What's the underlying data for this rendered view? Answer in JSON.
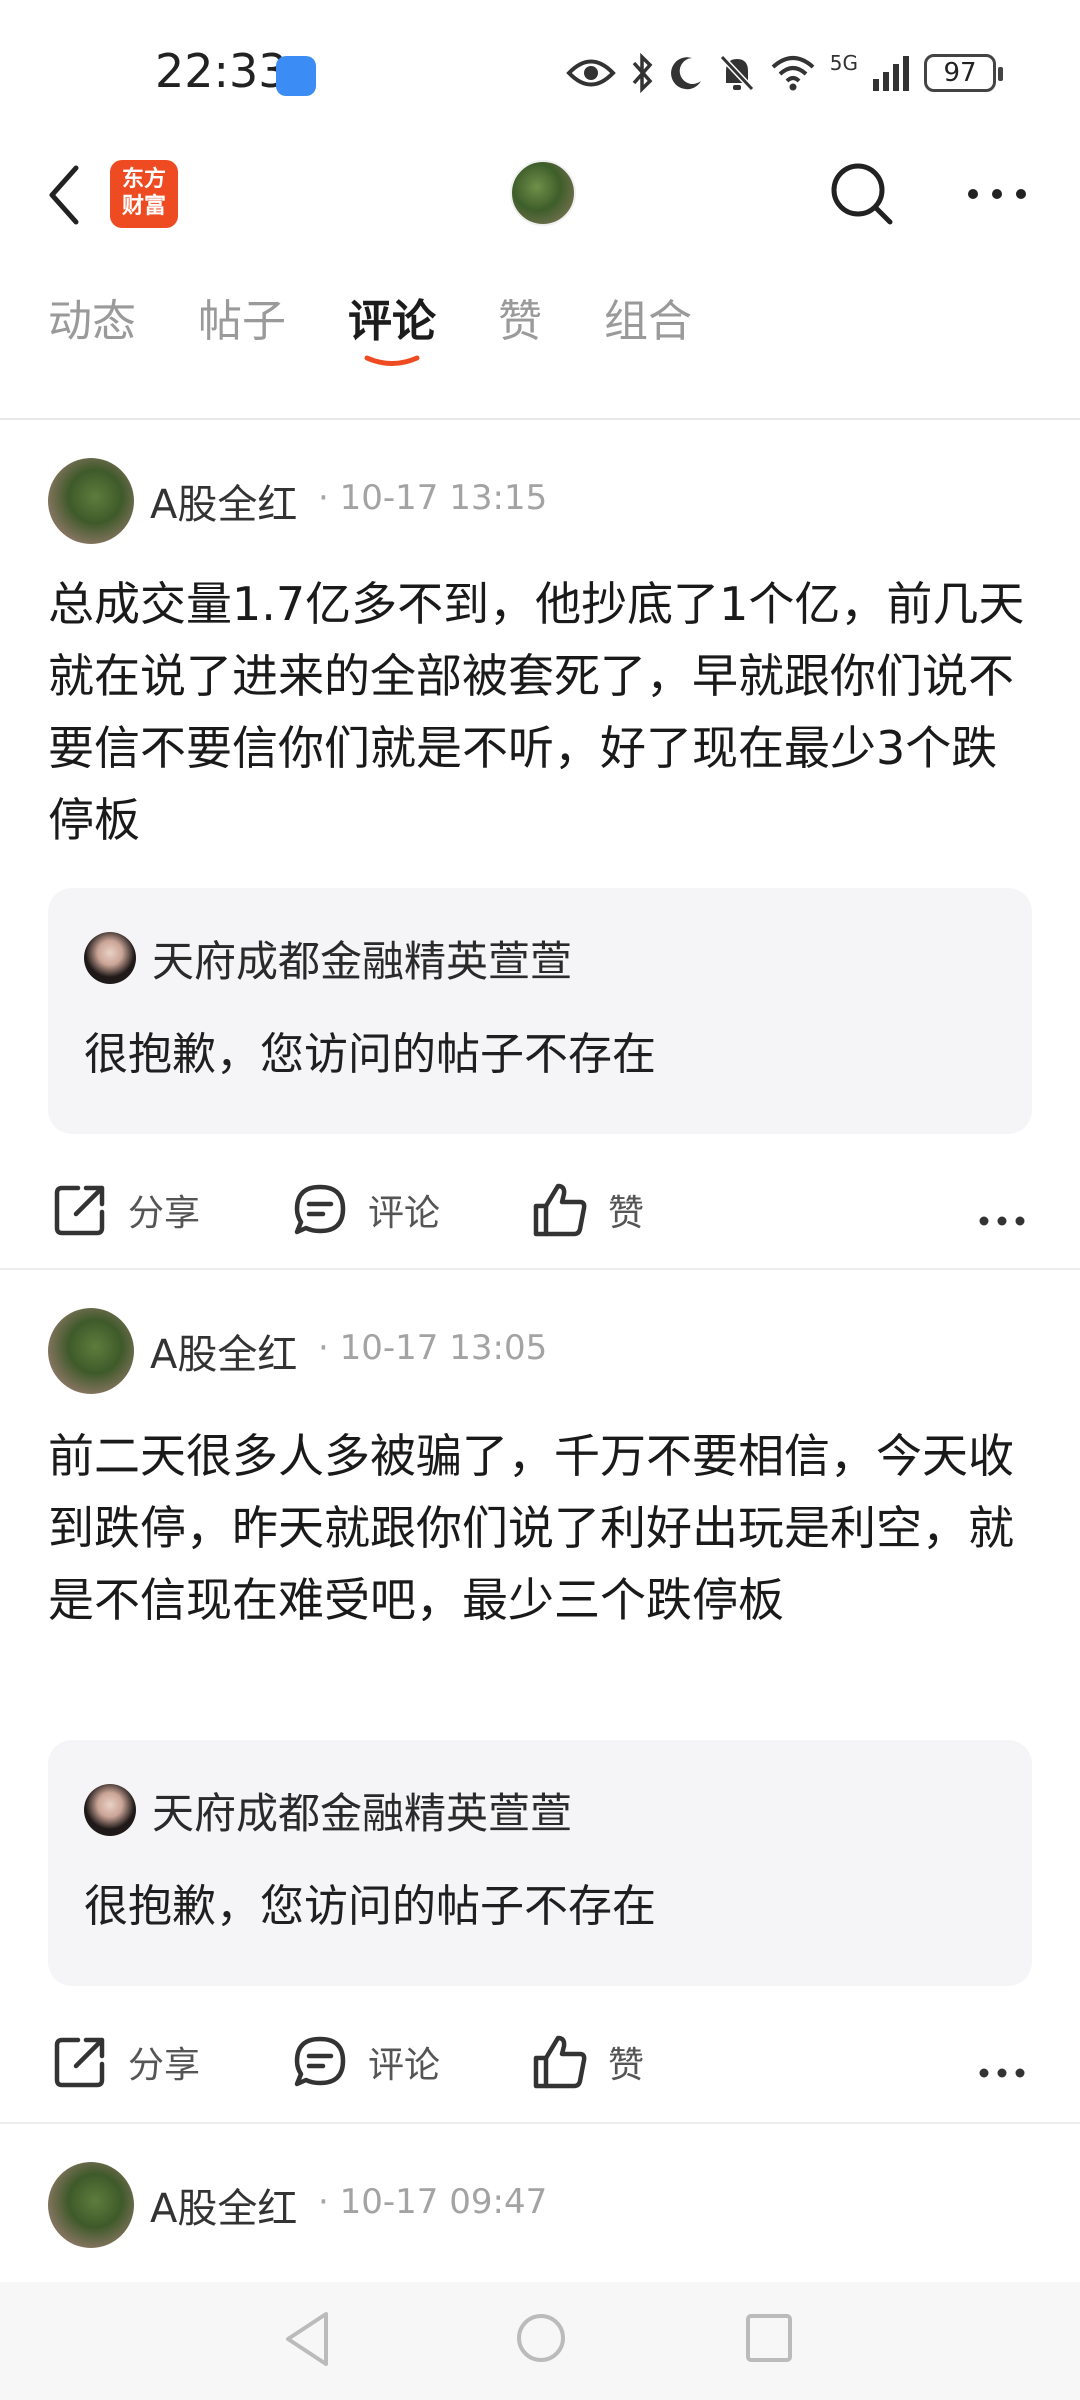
{
  "status": {
    "time": "22:33",
    "battery": "97",
    "network": "5G"
  },
  "nav": {
    "logo_line1": "东方",
    "logo_line2": "财富"
  },
  "tabs": [
    {
      "label": "动态",
      "active": false
    },
    {
      "label": "帖子",
      "active": false
    },
    {
      "label": "评论",
      "active": true
    },
    {
      "label": "赞",
      "active": false
    },
    {
      "label": "组合",
      "active": false
    }
  ],
  "posts": [
    {
      "author": "A股全红",
      "time": "10-17 13:15",
      "content": "总成交量1.7亿多不到，他抄底了1个亿，前几天就在说了进来的全部被套死了，早就跟你们说不要信不要信你们就是不听，好了现在最少3个跌停板",
      "quote": {
        "author": "天府成都金融精英萱萱",
        "text": "很抱歉，您访问的帖子不存在"
      }
    },
    {
      "author": "A股全红",
      "time": "10-17 13:05",
      "content": "前二天很多人多被骗了，千万不要相信，今天收到跌停，昨天就跟你们说了利好出玩是利空，就是不信现在难受吧，最少三个跌停板",
      "quote": {
        "author": "天府成都金融精英萱萱",
        "text": "很抱歉，您访问的帖子不存在"
      }
    },
    {
      "author": "A股全红",
      "time": "10-17 09:47"
    }
  ],
  "actions": {
    "share": "分享",
    "comment": "评论",
    "like": "赞"
  },
  "colors": {
    "accent": "#ef4b22",
    "tab_active": "#1c1c1c",
    "tab_inactive": "#9a9a9a",
    "quote_bg": "#f5f5f7"
  }
}
